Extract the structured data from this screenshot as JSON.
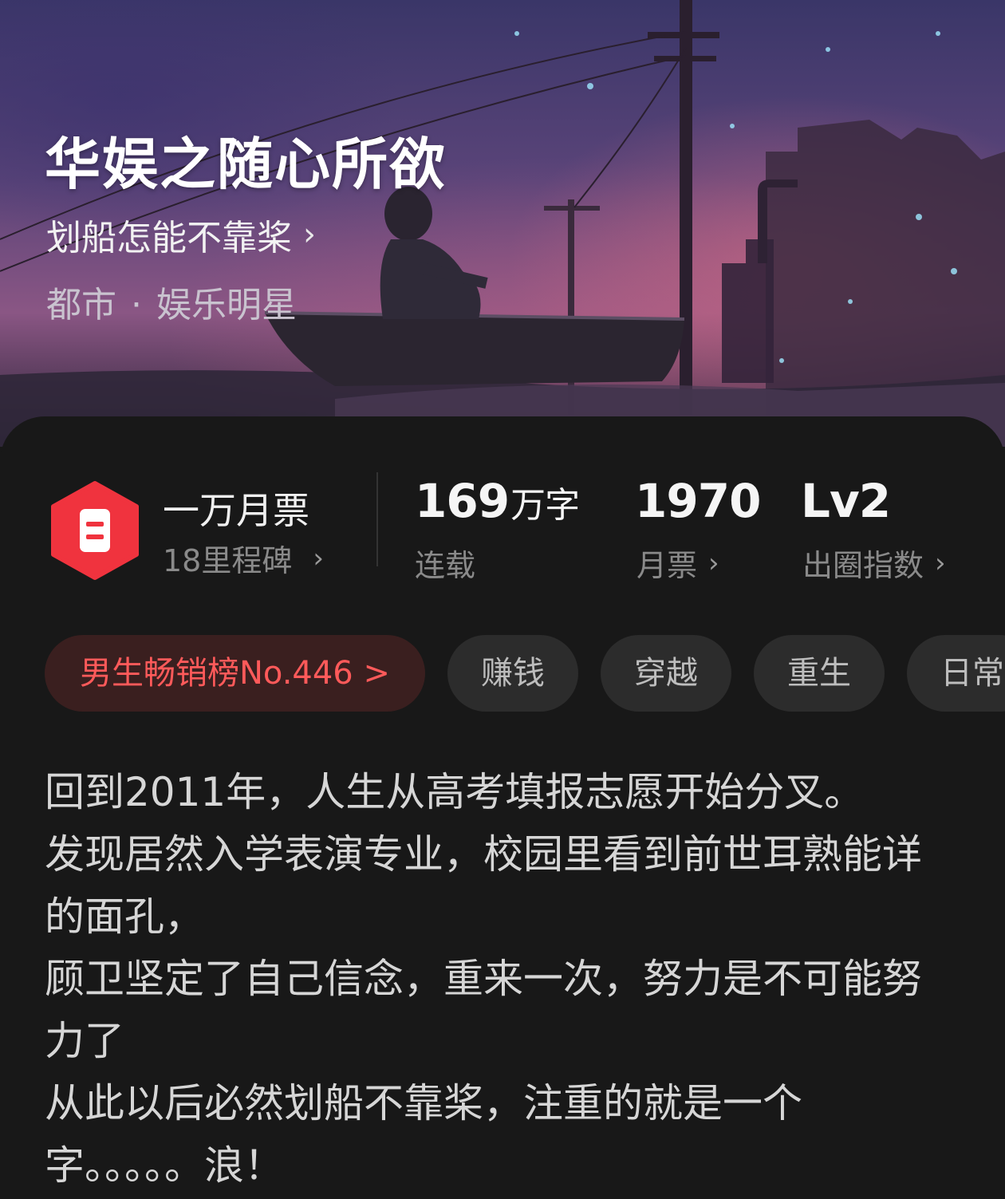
{
  "book": {
    "title": "华娱之随心所欲",
    "author": "划船怎能不靠桨",
    "category": "都市",
    "subcategory": "娱乐明星",
    "separator": "·"
  },
  "milestone": {
    "title": "一万月票",
    "subtitle": "18里程碑",
    "icon": "ticket-icon"
  },
  "stats": {
    "words_number": "169",
    "words_unit": "万字",
    "status_label": "连载",
    "monthly_tickets_number": "1970",
    "monthly_tickets_label": "月票",
    "breakout_level": "Lv2",
    "breakout_label": "出圈指数"
  },
  "tags": {
    "rank": "男生畅销榜No.446 >",
    "items": [
      "赚钱",
      "穿越",
      "重生",
      "日常"
    ]
  },
  "synopsis": "回到2011年，人生从高考填报志愿开始分叉。\n发现居然入学表演专业，校园里看到前世耳熟能详的面孔，\n顾卫坚定了自己信念，重来一次，努力是不可能努力了\n从此以后必然划船不靠桨，注重的就是一个字。。。。。浪！",
  "colors": {
    "accent_red": "#ff5a5a",
    "badge_red": "#f0333e",
    "card_bg": "#181818"
  },
  "icons": {
    "chevron": "chevron-right-icon"
  }
}
